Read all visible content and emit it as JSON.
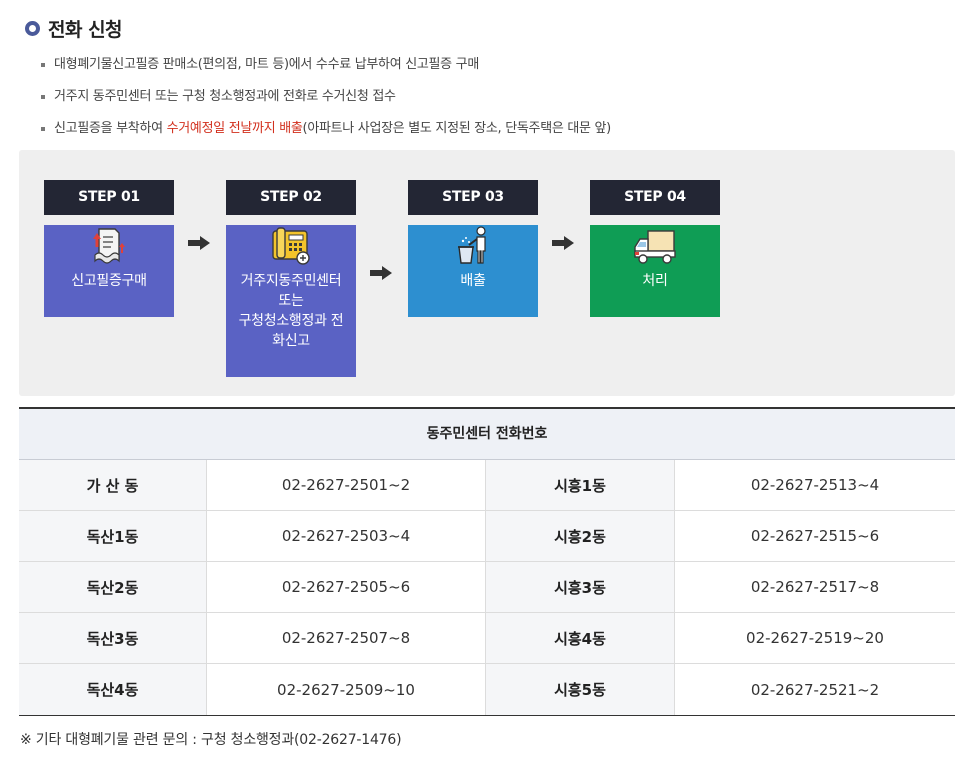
{
  "title": "전화 신청",
  "bullets": {
    "b1": "대형폐기물신고필증 판매소(편의점, 마트 등)에서 수수료 납부하여 신고필증 구매",
    "b2": "거주지 동주민센터 또는 구청 청소행정과에 전화로 수거신청 접수",
    "b3_prefix": "신고필증을 부착하여 ",
    "b3_highlight": "수거예정일 전날까지 배출",
    "b3_suffix": "(아파트나 사업장은 별도 지정된 장소, 단독주택은 대문 앞)"
  },
  "steps": [
    {
      "label": "STEP 01",
      "text_lines": [
        "신고필증구매"
      ],
      "color": "#5a62c4",
      "icon": "receipt-icon"
    },
    {
      "label": "STEP 02",
      "text_lines": [
        "거주지동주민센터",
        "또는",
        "구청청소행정과 전",
        "화신고"
      ],
      "color": "#5a62c4",
      "icon": "phone-icon"
    },
    {
      "label": "STEP 03",
      "text_lines": [
        "배출"
      ],
      "color": "#2d8fd0",
      "icon": "trash-person-icon"
    },
    {
      "label": "STEP 04",
      "text_lines": [
        "처리"
      ],
      "color": "#0f9d55",
      "icon": "truck-icon"
    }
  ],
  "table": {
    "header": "동주민센터 전화번호",
    "rows": [
      {
        "name1": "가 산 동",
        "phone1": "02-2627-2501~2",
        "name2": "시흥1동",
        "phone2": "02-2627-2513~4"
      },
      {
        "name1": "독산1동",
        "phone1": "02-2627-2503~4",
        "name2": "시흥2동",
        "phone2": "02-2627-2515~6"
      },
      {
        "name1": "독산2동",
        "phone1": "02-2627-2505~6",
        "name2": "시흥3동",
        "phone2": "02-2627-2517~8"
      },
      {
        "name1": "독산3동",
        "phone1": "02-2627-2507~8",
        "name2": "시흥4동",
        "phone2": "02-2627-2519~20"
      },
      {
        "name1": "독산4동",
        "phone1": "02-2627-2509~10",
        "name2": "시흥5동",
        "phone2": "02-2627-2521~2"
      }
    ]
  },
  "footnote": "※ 기타 대형폐기물 관련 문의 : 구청 청소행정과(02-2627-1476)"
}
